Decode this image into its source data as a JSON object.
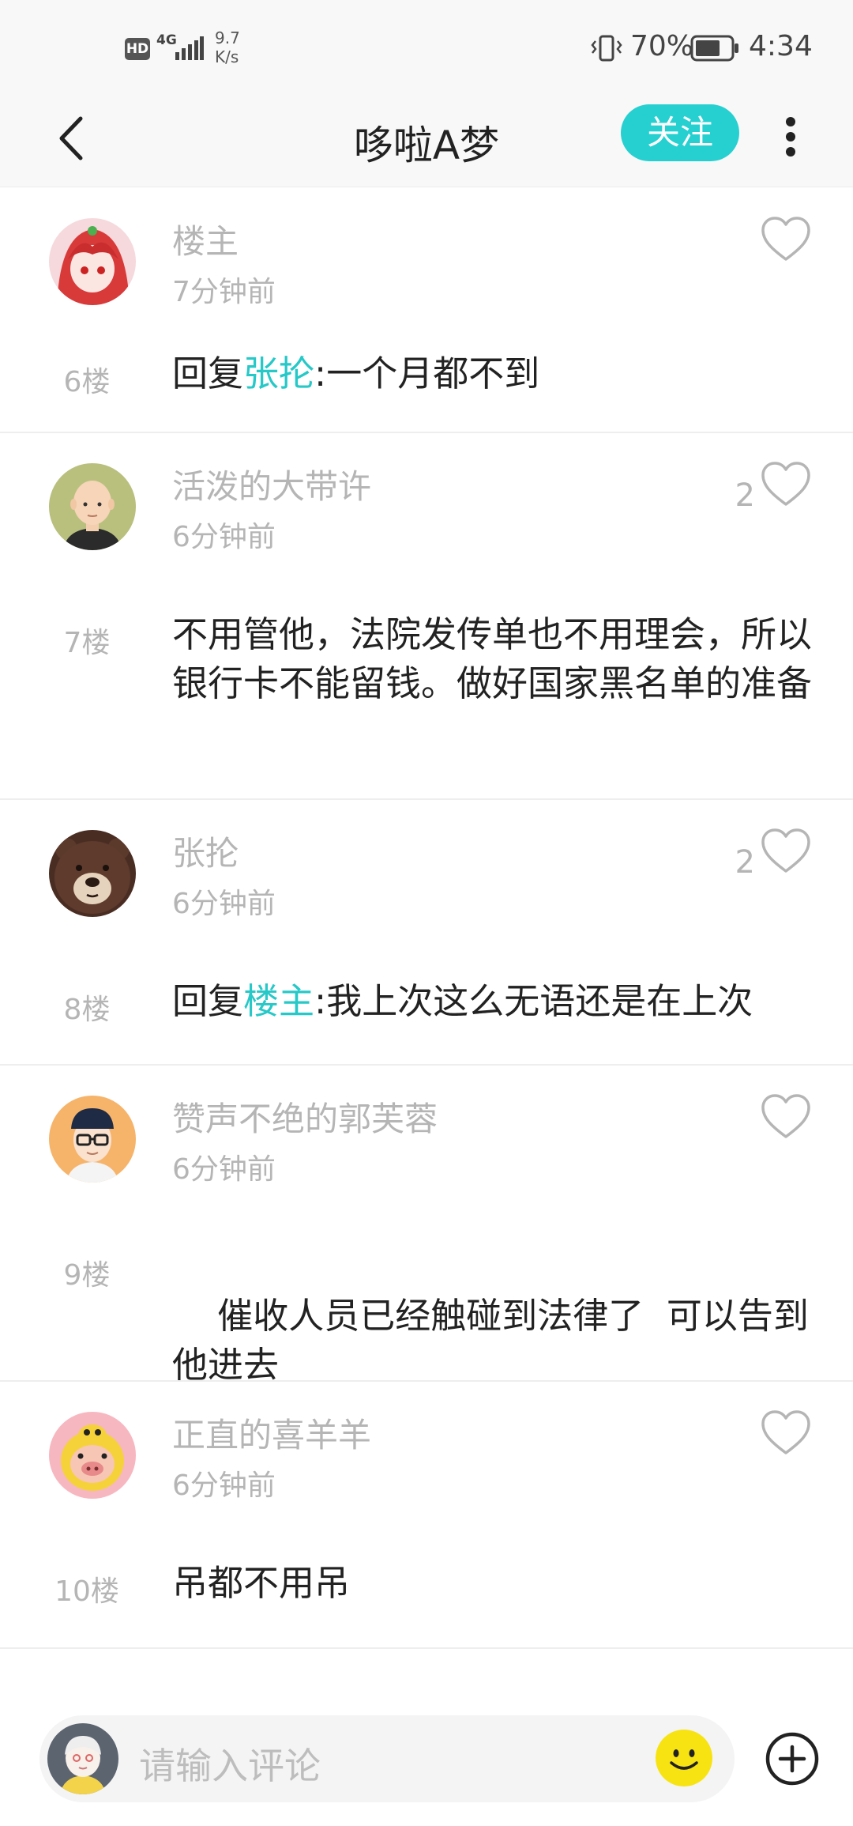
{
  "status_bar": {
    "hd": "HD",
    "network": "4G",
    "speed_value": "9.7",
    "speed_unit": "K/s",
    "battery_percent": "70%",
    "time": "4:34"
  },
  "header": {
    "title": "哆啦A梦",
    "follow_label": "关注"
  },
  "comments": [
    {
      "username": "楼主",
      "time": "7分钟前",
      "likes": "",
      "floor": "6楼",
      "reply_prefix": "回复",
      "reply_to": "张抡",
      "reply_sep": ":",
      "text": "一个月都不到"
    },
    {
      "username": "活泼的大带许",
      "time": "6分钟前",
      "likes": "2",
      "floor": "7楼",
      "text": "不用管他，法院发传单也不用理会，所以银行卡不能留钱。做好国家黑名单的准备"
    },
    {
      "username": "张抡",
      "time": "6分钟前",
      "likes": "2",
      "floor": "8楼",
      "reply_prefix": "回复",
      "reply_to": "楼主",
      "reply_sep": ":",
      "text": "我上次这么无语还是在上次"
    },
    {
      "username": "赞声不绝的郭芙蓉",
      "time": "6分钟前",
      "likes": "",
      "floor": "9楼",
      "text": "催收人员已经触碰到法律了  可以告到他进去"
    },
    {
      "username": "正直的喜羊羊",
      "time": "6分钟前",
      "likes": "",
      "floor": "10楼",
      "text": "吊都不用吊"
    }
  ],
  "composer": {
    "placeholder": "请输入评论"
  },
  "colors": {
    "accent": "#27d0d0",
    "muted_text": "#b5b5b5",
    "emoji_yellow": "#f7e312"
  }
}
